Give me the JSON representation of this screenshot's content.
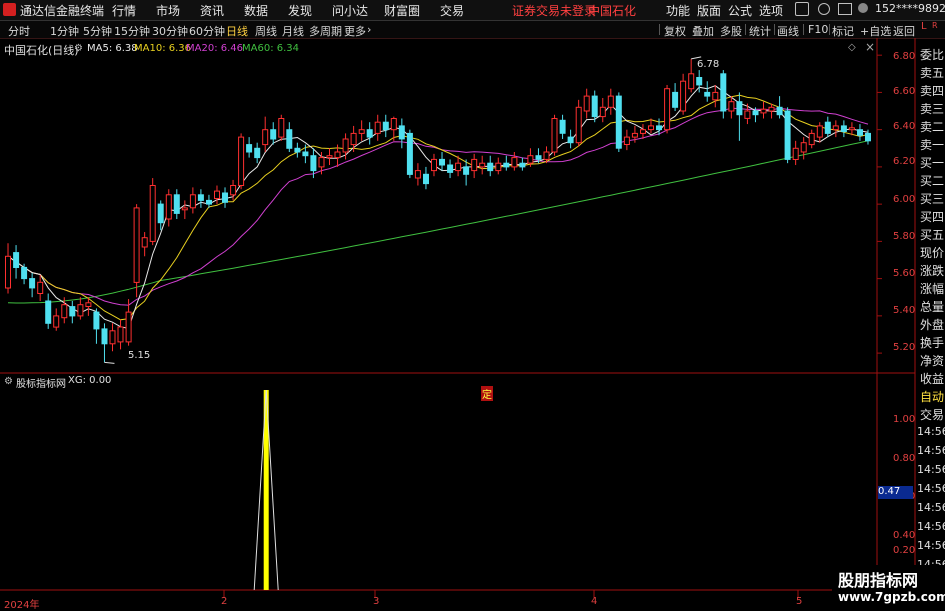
{
  "menu": {
    "app_title": "通达信金融终端",
    "items": [
      "行情",
      "市场",
      "资讯",
      "数据",
      "发现",
      "问小达",
      "财富圈",
      "交易"
    ],
    "notice": "证券交易未登录",
    "stock_name": "中国石化",
    "right_items": [
      "功能",
      "版面",
      "公式",
      "选项"
    ],
    "user": "152****9892"
  },
  "toolbar": {
    "periods": [
      "分时",
      "1分钟",
      "5分钟",
      "15分钟",
      "30分钟",
      "60分钟",
      "日线",
      "周线",
      "月线",
      "多周期",
      "更多"
    ],
    "active_period": "日线",
    "more_arrow": "›",
    "right_buttons": [
      "复权",
      "叠加",
      "多股",
      "统计",
      "画线",
      "F10",
      "+自选",
      "返回"
    ],
    "mark_l": "L",
    "mark_r": "R"
  },
  "main_panel": {
    "title": "中国石化(日线)",
    "ma": [
      {
        "label": "MA5: 6.38",
        "color": "#e8e8e8"
      },
      {
        "label": "MA10: 6.36",
        "color": "#e8d020"
      },
      {
        "label": "MA20: 6.46",
        "color": "#d040d0"
      },
      {
        "label": "MA60: 6.34",
        "color": "#40c040"
      }
    ],
    "high_label": "6.78",
    "low_label": "5.15",
    "marker": "定",
    "y_ticks": [
      "6.80",
      "6.60",
      "6.40",
      "6.20",
      "6.00",
      "5.80",
      "5.60",
      "5.40",
      "5.20"
    ]
  },
  "sub_panel": {
    "title": "股标指标网",
    "value_label": "XG: 0.00",
    "y_ticks": [
      "1.00",
      "0.80",
      "0.60",
      "0.40",
      "0.20"
    ],
    "cursor_value": "0.47"
  },
  "side_labels": [
    "委比",
    "卖五",
    "卖四",
    "卖三",
    "卖二",
    "卖一",
    "买一",
    "买二",
    "买三",
    "买四",
    "买五",
    "现价",
    "涨跌",
    "涨幅",
    "总量",
    "外盘",
    "换手",
    "净资",
    "收益"
  ],
  "side_bottom": {
    "auto": "自动",
    "trade": "交易",
    "times": [
      "14:56",
      "14:56",
      "14:56",
      "14:56",
      "14:56",
      "14:56",
      "14:56",
      "14:56"
    ]
  },
  "x_axis": {
    "labels": [
      "2024年",
      "2",
      "3",
      "4",
      "5"
    ]
  },
  "watermark": {
    "line1": "股朋指标网",
    "line2": "www.7gpzb.com"
  },
  "colors": {
    "up": "#ff3030",
    "down": "#50e0f0",
    "ma5": "#e8e8e8",
    "ma10": "#e8d020",
    "ma20": "#d040d0",
    "ma60": "#40c040",
    "signal": "#ffff00"
  },
  "chart_data": {
    "type": "candlestick",
    "price_range": [
      5.12,
      6.86
    ],
    "candles": [
      {
        "o": 5.55,
        "c": 5.72,
        "h": 5.79,
        "l": 5.52
      },
      {
        "o": 5.74,
        "c": 5.66,
        "h": 5.78,
        "l": 5.6
      },
      {
        "o": 5.66,
        "c": 5.6,
        "h": 5.68,
        "l": 5.57
      },
      {
        "o": 5.6,
        "c": 5.55,
        "h": 5.63,
        "l": 5.5
      },
      {
        "o": 5.52,
        "c": 5.58,
        "h": 5.62,
        "l": 5.48
      },
      {
        "o": 5.48,
        "c": 5.36,
        "h": 5.52,
        "l": 5.33
      },
      {
        "o": 5.34,
        "c": 5.4,
        "h": 5.44,
        "l": 5.32
      },
      {
        "o": 5.39,
        "c": 5.46,
        "h": 5.5,
        "l": 5.36
      },
      {
        "o": 5.45,
        "c": 5.4,
        "h": 5.48,
        "l": 5.36
      },
      {
        "o": 5.4,
        "c": 5.46,
        "h": 5.5,
        "l": 5.38
      },
      {
        "o": 5.45,
        "c": 5.47,
        "h": 5.5,
        "l": 5.4
      },
      {
        "o": 5.42,
        "c": 5.33,
        "h": 5.44,
        "l": 5.25
      },
      {
        "o": 5.33,
        "c": 5.25,
        "h": 5.36,
        "l": 5.15
      },
      {
        "o": 5.25,
        "c": 5.32,
        "h": 5.36,
        "l": 5.21
      },
      {
        "o": 5.26,
        "c": 5.34,
        "h": 5.38,
        "l": 5.22
      },
      {
        "o": 5.26,
        "c": 5.42,
        "h": 5.49,
        "l": 5.24
      },
      {
        "o": 5.58,
        "c": 5.98,
        "h": 6.0,
        "l": 5.5
      },
      {
        "o": 5.77,
        "c": 5.82,
        "h": 5.85,
        "l": 5.72
      },
      {
        "o": 5.8,
        "c": 6.1,
        "h": 6.14,
        "l": 5.78
      },
      {
        "o": 6.0,
        "c": 5.9,
        "h": 6.02,
        "l": 5.86
      },
      {
        "o": 5.92,
        "c": 6.05,
        "h": 6.08,
        "l": 5.88
      },
      {
        "o": 6.05,
        "c": 5.95,
        "h": 6.08,
        "l": 5.92
      },
      {
        "o": 5.97,
        "c": 5.98,
        "h": 6.02,
        "l": 5.92
      },
      {
        "o": 5.98,
        "c": 6.05,
        "h": 6.09,
        "l": 5.95
      },
      {
        "o": 6.05,
        "c": 6.02,
        "h": 6.08,
        "l": 5.98
      },
      {
        "o": 6.02,
        "c": 6.0,
        "h": 6.05,
        "l": 5.98
      },
      {
        "o": 6.03,
        "c": 6.07,
        "h": 6.1,
        "l": 6.0
      },
      {
        "o": 6.06,
        "c": 6.01,
        "h": 6.09,
        "l": 5.98
      },
      {
        "o": 6.05,
        "c": 6.1,
        "h": 6.13,
        "l": 6.02
      },
      {
        "o": 6.1,
        "c": 6.36,
        "h": 6.38,
        "l": 6.08
      },
      {
        "o": 6.32,
        "c": 6.28,
        "h": 6.36,
        "l": 6.25
      },
      {
        "o": 6.3,
        "c": 6.25,
        "h": 6.33,
        "l": 6.22
      },
      {
        "o": 6.32,
        "c": 6.4,
        "h": 6.47,
        "l": 6.28
      },
      {
        "o": 6.4,
        "c": 6.35,
        "h": 6.44,
        "l": 6.32
      },
      {
        "o": 6.36,
        "c": 6.46,
        "h": 6.48,
        "l": 6.34
      },
      {
        "o": 6.4,
        "c": 6.3,
        "h": 6.44,
        "l": 6.28
      },
      {
        "o": 6.3,
        "c": 6.28,
        "h": 6.33,
        "l": 6.25
      },
      {
        "o": 6.28,
        "c": 6.26,
        "h": 6.32,
        "l": 6.22
      },
      {
        "o": 6.26,
        "c": 6.18,
        "h": 6.3,
        "l": 6.14
      },
      {
        "o": 6.2,
        "c": 6.25,
        "h": 6.28,
        "l": 6.16
      },
      {
        "o": 6.25,
        "c": 6.26,
        "h": 6.3,
        "l": 6.21
      },
      {
        "o": 6.25,
        "c": 6.28,
        "h": 6.32,
        "l": 6.2
      },
      {
        "o": 6.28,
        "c": 6.35,
        "h": 6.38,
        "l": 6.24
      },
      {
        "o": 6.32,
        "c": 6.38,
        "h": 6.42,
        "l": 6.28
      },
      {
        "o": 6.38,
        "c": 6.4,
        "h": 6.45,
        "l": 6.34
      },
      {
        "o": 6.4,
        "c": 6.36,
        "h": 6.44,
        "l": 6.32
      },
      {
        "o": 6.38,
        "c": 6.44,
        "h": 6.48,
        "l": 6.34
      },
      {
        "o": 6.44,
        "c": 6.4,
        "h": 6.48,
        "l": 6.36
      },
      {
        "o": 6.4,
        "c": 6.46,
        "h": 6.47,
        "l": 6.34
      },
      {
        "o": 6.42,
        "c": 6.35,
        "h": 6.46,
        "l": 6.3
      },
      {
        "o": 6.38,
        "c": 6.16,
        "h": 6.4,
        "l": 6.14
      },
      {
        "o": 6.14,
        "c": 6.18,
        "h": 6.22,
        "l": 6.1
      },
      {
        "o": 6.16,
        "c": 6.11,
        "h": 6.2,
        "l": 6.08
      },
      {
        "o": 6.18,
        "c": 6.24,
        "h": 6.27,
        "l": 6.15
      },
      {
        "o": 6.24,
        "c": 6.21,
        "h": 6.28,
        "l": 6.18
      },
      {
        "o": 6.21,
        "c": 6.17,
        "h": 6.24,
        "l": 6.14
      },
      {
        "o": 6.18,
        "c": 6.22,
        "h": 6.26,
        "l": 6.15
      },
      {
        "o": 6.2,
        "c": 6.16,
        "h": 6.24,
        "l": 6.1
      },
      {
        "o": 6.18,
        "c": 6.24,
        "h": 6.27,
        "l": 6.14
      },
      {
        "o": 6.2,
        "c": 6.22,
        "h": 6.26,
        "l": 6.16
      },
      {
        "o": 6.22,
        "c": 6.18,
        "h": 6.26,
        "l": 6.15
      },
      {
        "o": 6.18,
        "c": 6.22,
        "h": 6.25,
        "l": 6.16
      },
      {
        "o": 6.22,
        "c": 6.2,
        "h": 6.26,
        "l": 6.18
      },
      {
        "o": 6.2,
        "c": 6.25,
        "h": 6.28,
        "l": 6.18
      },
      {
        "o": 6.22,
        "c": 6.2,
        "h": 6.25,
        "l": 6.18
      },
      {
        "o": 6.22,
        "c": 6.26,
        "h": 6.3,
        "l": 6.2
      },
      {
        "o": 6.26,
        "c": 6.24,
        "h": 6.3,
        "l": 6.22
      },
      {
        "o": 6.24,
        "c": 6.28,
        "h": 6.31,
        "l": 6.22
      },
      {
        "o": 6.28,
        "c": 6.46,
        "h": 6.48,
        "l": 6.26
      },
      {
        "o": 6.45,
        "c": 6.38,
        "h": 6.48,
        "l": 6.35
      },
      {
        "o": 6.36,
        "c": 6.33,
        "h": 6.4,
        "l": 6.3
      },
      {
        "o": 6.33,
        "c": 6.52,
        "h": 6.56,
        "l": 6.31
      },
      {
        "o": 6.5,
        "c": 6.58,
        "h": 6.62,
        "l": 6.46
      },
      {
        "o": 6.58,
        "c": 6.47,
        "h": 6.61,
        "l": 6.44
      },
      {
        "o": 6.47,
        "c": 6.52,
        "h": 6.57,
        "l": 6.44
      },
      {
        "o": 6.52,
        "c": 6.58,
        "h": 6.62,
        "l": 6.48
      },
      {
        "o": 6.58,
        "c": 6.3,
        "h": 6.6,
        "l": 6.28
      },
      {
        "o": 6.32,
        "c": 6.36,
        "h": 6.4,
        "l": 6.29
      },
      {
        "o": 6.36,
        "c": 6.38,
        "h": 6.42,
        "l": 6.33
      },
      {
        "o": 6.38,
        "c": 6.4,
        "h": 6.43,
        "l": 6.35
      },
      {
        "o": 6.4,
        "c": 6.42,
        "h": 6.46,
        "l": 6.38
      },
      {
        "o": 6.42,
        "c": 6.4,
        "h": 6.46,
        "l": 6.37
      },
      {
        "o": 6.4,
        "c": 6.62,
        "h": 6.64,
        "l": 6.38
      },
      {
        "o": 6.6,
        "c": 6.52,
        "h": 6.65,
        "l": 6.5
      },
      {
        "o": 6.5,
        "c": 6.66,
        "h": 6.7,
        "l": 6.48
      },
      {
        "o": 6.62,
        "c": 6.7,
        "h": 6.78,
        "l": 6.6
      },
      {
        "o": 6.68,
        "c": 6.64,
        "h": 6.72,
        "l": 6.6
      },
      {
        "o": 6.6,
        "c": 6.58,
        "h": 6.66,
        "l": 6.55
      },
      {
        "o": 6.56,
        "c": 6.6,
        "h": 6.64,
        "l": 6.52
      },
      {
        "o": 6.7,
        "c": 6.5,
        "h": 6.72,
        "l": 6.46
      },
      {
        "o": 6.5,
        "c": 6.55,
        "h": 6.58,
        "l": 6.46
      },
      {
        "o": 6.55,
        "c": 6.48,
        "h": 6.6,
        "l": 6.34
      },
      {
        "o": 6.46,
        "c": 6.5,
        "h": 6.54,
        "l": 6.43
      },
      {
        "o": 6.5,
        "c": 6.48,
        "h": 6.52,
        "l": 6.44
      },
      {
        "o": 6.49,
        "c": 6.51,
        "h": 6.55,
        "l": 6.46
      },
      {
        "o": 6.5,
        "c": 6.52,
        "h": 6.54,
        "l": 6.46
      },
      {
        "o": 6.52,
        "c": 6.48,
        "h": 6.58,
        "l": 6.46
      },
      {
        "o": 6.5,
        "c": 6.24,
        "h": 6.52,
        "l": 6.22
      },
      {
        "o": 6.24,
        "c": 6.3,
        "h": 6.34,
        "l": 6.21
      },
      {
        "o": 6.28,
        "c": 6.33,
        "h": 6.36,
        "l": 6.24
      },
      {
        "o": 6.32,
        "c": 6.38,
        "h": 6.4,
        "l": 6.3
      },
      {
        "o": 6.36,
        "c": 6.42,
        "h": 6.44,
        "l": 6.33
      },
      {
        "o": 6.44,
        "c": 6.38,
        "h": 6.47,
        "l": 6.36
      },
      {
        "o": 6.4,
        "c": 6.42,
        "h": 6.45,
        "l": 6.36
      },
      {
        "o": 6.42,
        "c": 6.39,
        "h": 6.45,
        "l": 6.36
      },
      {
        "o": 6.4,
        "c": 6.41,
        "h": 6.44,
        "l": 6.37
      },
      {
        "o": 6.4,
        "c": 6.37,
        "h": 6.43,
        "l": 6.34
      },
      {
        "o": 6.38,
        "c": 6.34,
        "h": 6.4,
        "l": 6.32
      }
    ],
    "signal": {
      "index": 32,
      "value": 1
    }
  }
}
